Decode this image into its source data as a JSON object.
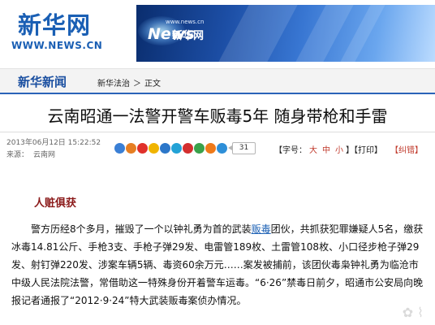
{
  "header": {
    "logo_cn": "新华网",
    "logo_url": "WWW.NEWS.CN",
    "banner_url": "www.news.cn",
    "banner_cn": "新华网",
    "banner_news": "News"
  },
  "nav": {
    "brand": "新华新闻",
    "breadcrumb": [
      "新华法治",
      "正文"
    ],
    "separator": "＞"
  },
  "article": {
    "title": "云南昭通一法警开警车贩毒5年 随身带枪和手雷",
    "date": "2013年06月12日 15:22:52",
    "source_label": "来源：",
    "source_value": "云南网",
    "share_count": "31",
    "section_head": "人赃俱获",
    "paragraph_before": "警方历经8个多月，摧毁了一个以钟礼勇为首的武装",
    "paragraph_link": "贩毒",
    "paragraph_after": "团伙，共抓获犯罪嫌疑人5名，缴获冰毒14.81公斤、手枪3支、手枪子弹29发、电雷管189枚、土雷管108枚、小口径步枪子弹29发、射钉弹220发、涉案车辆5辆、毒资60余万元……案发被捕前，该团伙毒枭钟礼勇为临沧市中级人民法院法警，常借助这一特殊身份开着警车运毒。“6·26”禁毒日前夕，昭通市公安局向晚报记者通报了“2012·9·24”特大武装贩毒案侦办情况。"
  },
  "tools": {
    "font_label_open": "【字号：",
    "font_large": "大",
    "font_medium": "中",
    "font_small": "小",
    "close_bracket": "】",
    "print": "【打印】",
    "correct": "【纠错】"
  },
  "share_icons": [
    {
      "name": "share-plus-icon",
      "color": "#3a7fd5"
    },
    {
      "name": "share-kaixin-icon",
      "color": "#e67e22"
    },
    {
      "name": "share-weibo-icon",
      "color": "#e0312b"
    },
    {
      "name": "share-qzone-icon",
      "color": "#f0b400"
    },
    {
      "name": "share-renren-icon",
      "color": "#2c77c9"
    },
    {
      "name": "share-tencent-weibo-icon",
      "color": "#23a2d6"
    },
    {
      "name": "share-people-icon",
      "color": "#d32f2f"
    },
    {
      "name": "share-douban-icon",
      "color": "#3aa14a"
    },
    {
      "name": "share-feixin-icon",
      "color": "#ef7a1a"
    },
    {
      "name": "share-more-icon",
      "color": "#2e8fd8"
    }
  ]
}
